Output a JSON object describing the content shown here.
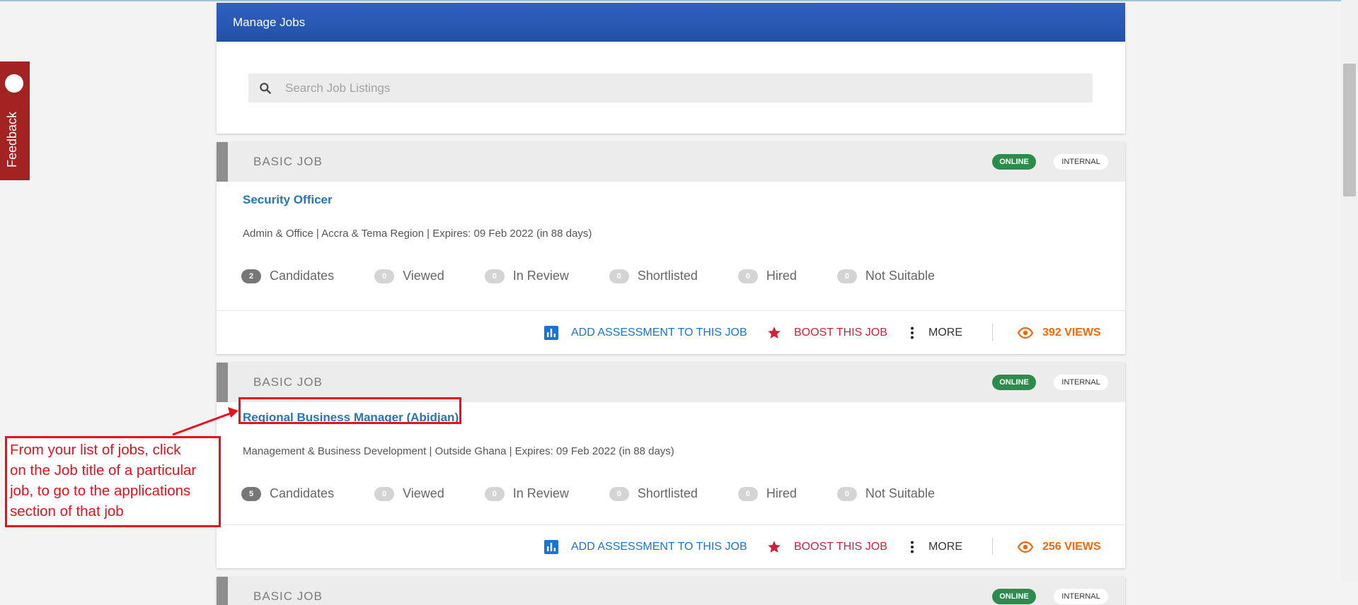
{
  "header": {
    "title": "Manage Jobs"
  },
  "search": {
    "placeholder": "Search Job Listings"
  },
  "feedback": {
    "label": "Feedback"
  },
  "jobs": [
    {
      "type": "BASIC JOB",
      "status": "ONLINE",
      "visibility": "INTERNAL",
      "title": "Security Officer",
      "meta": "Admin & Office | Accra & Tema Region | Expires: 09 Feb 2022 (in 88 days)",
      "stats": [
        {
          "count": "2",
          "label": "Candidates"
        },
        {
          "count": "0",
          "label": "Viewed"
        },
        {
          "count": "0",
          "label": "In Review"
        },
        {
          "count": "0",
          "label": "Shortlisted"
        },
        {
          "count": "0",
          "label": "Hired"
        },
        {
          "count": "0",
          "label": "Not Suitable"
        }
      ],
      "actions": {
        "assessment": "ADD ASSESSMENT TO THIS JOB",
        "boost": "BOOST THIS JOB",
        "more": "MORE"
      },
      "views": "392 VIEWS"
    },
    {
      "type": "BASIC JOB",
      "status": "ONLINE",
      "visibility": "INTERNAL",
      "title": "Regional Business Manager (Abidjan)",
      "meta": "Management & Business Development | Outside Ghana | Expires: 09 Feb 2022 (in 88 days)",
      "stats": [
        {
          "count": "5",
          "label": "Candidates"
        },
        {
          "count": "0",
          "label": "Viewed"
        },
        {
          "count": "0",
          "label": "In Review"
        },
        {
          "count": "0",
          "label": "Shortlisted"
        },
        {
          "count": "0",
          "label": "Hired"
        },
        {
          "count": "0",
          "label": "Not Suitable"
        }
      ],
      "actions": {
        "assessment": "ADD ASSESSMENT TO THIS JOB",
        "boost": "BOOST THIS JOB",
        "more": "MORE"
      },
      "views": "256 VIEWS"
    },
    {
      "type": "BASIC JOB",
      "status": "ONLINE",
      "visibility": "INTERNAL"
    }
  ],
  "annotation": {
    "text": "From your list of jobs, click\non the Job title of a particular\n job, to go to the applications\nsection of that job",
    "color": "#e8101a"
  },
  "colors": {
    "header": "#2a58b4",
    "link": "#2775b6",
    "assessment": "#1a73d8",
    "boost": "#d21f3c",
    "views": "#f2690c",
    "online": "#2e8b4e",
    "feedback": "#a32222"
  }
}
